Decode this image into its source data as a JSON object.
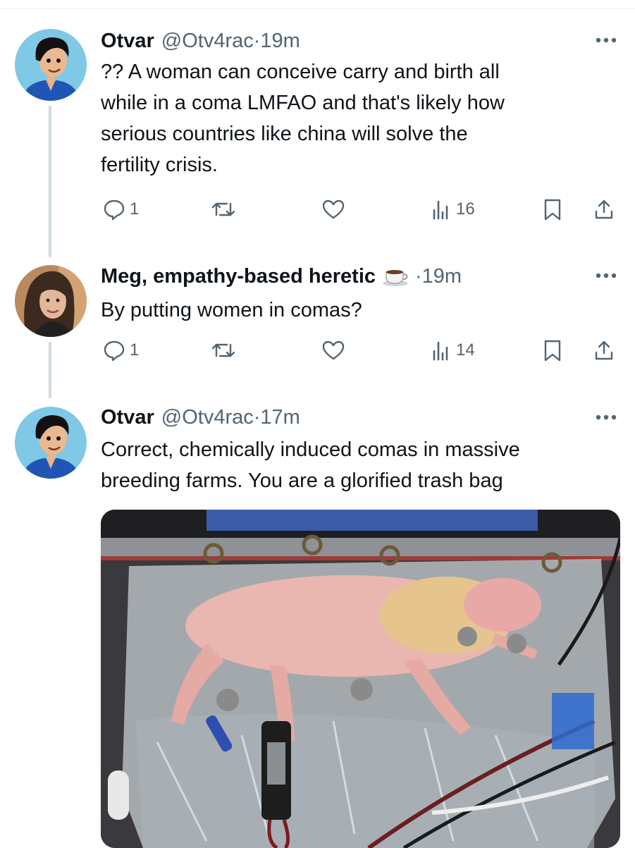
{
  "tweets": [
    {
      "name": "Otvar",
      "handle": "@Otv4rac",
      "time": "·19m",
      "text_lines": [
        "?? A woman can conceive carry and birth all",
        "while in a coma LMFAO and that's likely how",
        "serious countries like china will solve the",
        "fertility crisis."
      ],
      "stats": {
        "replies": "1",
        "views": "16"
      },
      "avatar_icon": "cartoon-boy-avatar"
    },
    {
      "name": "Meg, empathy-based heretic",
      "name_emoji": "coffee-cup-emoji",
      "time": "·19m",
      "text_lines": [
        "By putting women in comas?"
      ],
      "stats": {
        "replies": "1",
        "views": "14"
      },
      "avatar_icon": "woman-photo-avatar"
    },
    {
      "name": "Otvar",
      "handle": "@Otv4rac",
      "time": "·17m",
      "text_lines": [
        "Correct, chemically induced comas in massive",
        "breeding farms.  You are a glorified trash bag"
      ],
      "media_icon": "lamb-in-artificial-womb-photo",
      "avatar_icon": "cartoon-boy-avatar"
    }
  ],
  "icons": [
    "reply-icon",
    "retweet-icon",
    "like-icon",
    "views-icon",
    "bookmark-icon",
    "share-icon",
    "more-icon"
  ],
  "colors": {
    "text": "#0f1419",
    "secondary": "#536471",
    "thread_line": "#cfd9de"
  }
}
